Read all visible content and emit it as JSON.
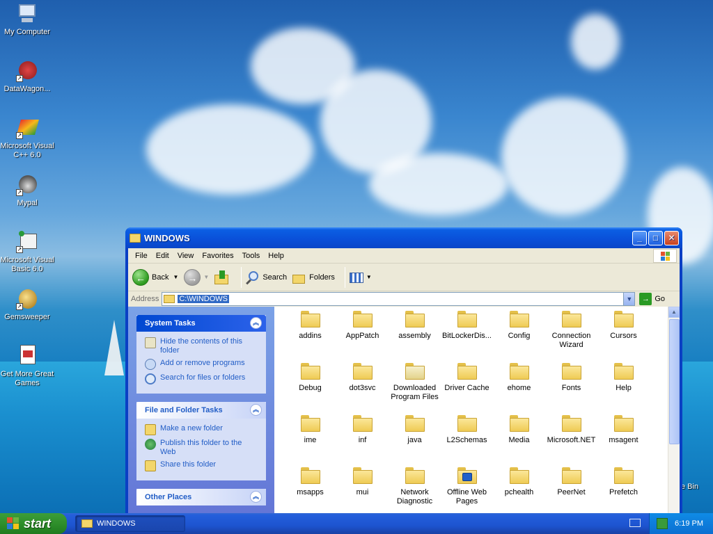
{
  "desktop": {
    "icons": [
      {
        "label": "My Computer",
        "icon": "computer-icon"
      },
      {
        "label": "DataWagon...",
        "icon": "app-icon"
      },
      {
        "label": "Microsoft Visual C++ 6.0",
        "icon": "app-icon"
      },
      {
        "label": "Mypal",
        "icon": "browser-icon"
      },
      {
        "label": "Microsoft Visual Basic 6.0",
        "icon": "app-icon"
      },
      {
        "label": "Gemsweeper",
        "icon": "game-icon"
      },
      {
        "label": "Get More Great Games",
        "icon": "document-icon"
      }
    ],
    "partial_label": "e Bin"
  },
  "window": {
    "title": "WINDOWS",
    "menu": [
      "File",
      "Edit",
      "View",
      "Favorites",
      "Tools",
      "Help"
    ],
    "toolbar": {
      "back": "Back",
      "search": "Search",
      "folders": "Folders"
    },
    "address": {
      "label": "Address",
      "value": "C:\\WINDOWS",
      "go": "Go"
    },
    "task_panels": [
      {
        "title": "System Tasks",
        "tasks": [
          "Hide the contents of this folder",
          "Add or remove programs",
          "Search for files or folders"
        ]
      },
      {
        "title": "File and Folder Tasks",
        "tasks": [
          "Make a new folder",
          "Publish this folder to the Web",
          "Share this folder"
        ]
      },
      {
        "title": "Other Places",
        "tasks": []
      }
    ],
    "files": [
      "addins",
      "AppPatch",
      "assembly",
      "BitLockerDis...",
      "Config",
      "Connection Wizard",
      "Cursors",
      "Debug",
      "dot3svc",
      "Downloaded Program Files",
      "Driver Cache",
      "ehome",
      "Fonts",
      "Help",
      "ime",
      "inf",
      "java",
      "L2Schemas",
      "Media",
      "Microsoft.NET",
      "msagent",
      "msapps",
      "mui",
      "Network Diagnostic",
      "Offline Web Pages",
      "pchealth",
      "PeerNet",
      "Prefetch"
    ]
  },
  "taskbar": {
    "start": "start",
    "active_window": "WINDOWS",
    "clock": "6:19 PM"
  },
  "colors": {
    "titlebar": "#0a4fd8",
    "start_green": "#2f8f2b",
    "link_blue": "#215dc6"
  }
}
